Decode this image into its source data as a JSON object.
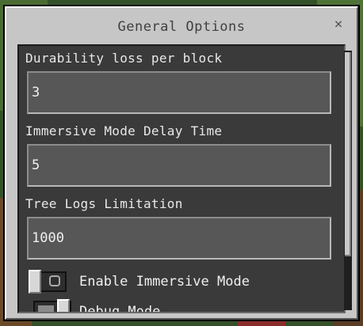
{
  "dialog": {
    "title": "General Options",
    "close_label": "×"
  },
  "settings": [
    {
      "label": "Durability loss per block",
      "value": "3"
    },
    {
      "label": "Immersive Mode Delay Time",
      "value": "5"
    },
    {
      "label": "Tree Logs Limitation",
      "value": "1000"
    }
  ],
  "toggles": [
    {
      "label": "Enable Immersive Mode",
      "state": "off"
    },
    {
      "label": "Debug Mode",
      "state": "on"
    }
  ],
  "colors": {
    "dialog_bg": "#c6c6c6",
    "panel_bg": "#3a3a3a",
    "field_bg": "#575757",
    "text_light": "#e8e8e8",
    "title_text": "#404040"
  }
}
